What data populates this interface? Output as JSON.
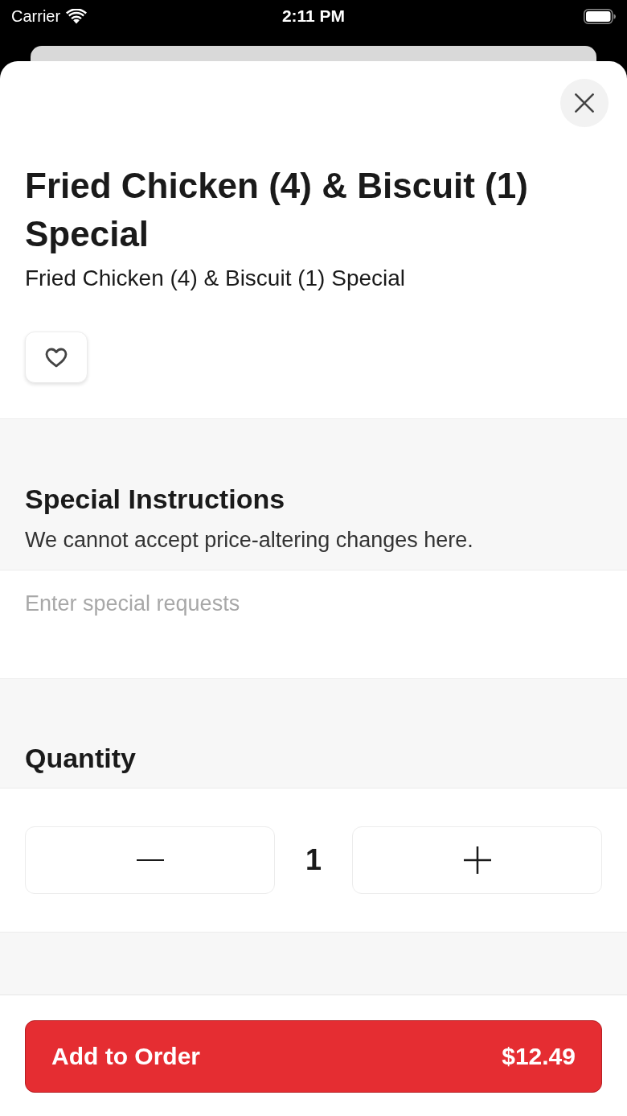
{
  "status_bar": {
    "carrier": "Carrier",
    "time": "2:11 PM"
  },
  "item": {
    "title": "Fried Chicken (4) & Biscuit (1) Special",
    "description": "Fried Chicken (4) & Biscuit (1) Special",
    "favorite": false
  },
  "special_instructions": {
    "heading": "Special Instructions",
    "note": "We cannot accept price-altering changes here.",
    "placeholder": "Enter special requests"
  },
  "quantity": {
    "heading": "Quantity",
    "value": "1"
  },
  "add_button": {
    "label": "Add to Order",
    "price": "$12.49"
  }
}
